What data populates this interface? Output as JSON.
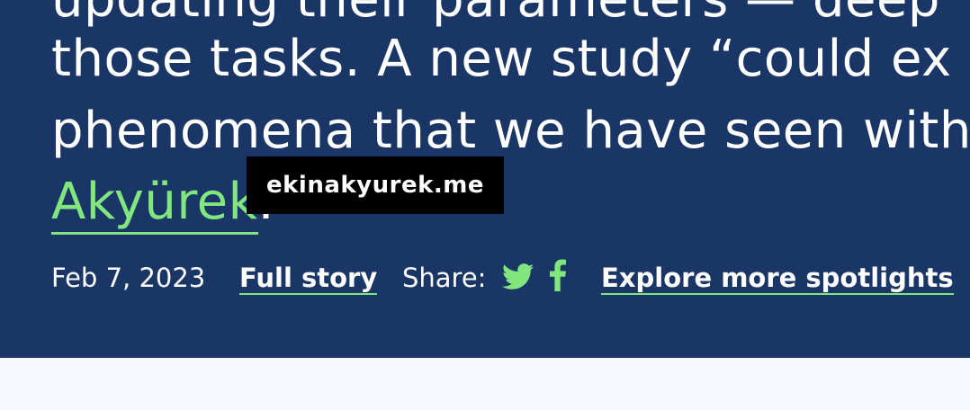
{
  "article": {
    "lines": [
      "updating their parameters — deep",
      "those tasks. A new study “could ex",
      "phenomena that we have seen with",
      "Akyürek"
    ],
    "line3_suffix": ".",
    "link_tooltip": "ekinakyurek.me"
  },
  "meta": {
    "date": "Feb 7, 2023",
    "full_story_label": "Full story",
    "share_label": "Share:",
    "explore_label": "Explore more spotlights"
  },
  "icons": {
    "share_twitter": "twitter-icon",
    "share_facebook": "facebook-icon"
  },
  "colors": {
    "hero_bg": "#1a3667",
    "accent": "#82e67f",
    "text": "#ffffff",
    "tooltip_bg": "#000000",
    "page_bg": "#f5f8fd"
  }
}
